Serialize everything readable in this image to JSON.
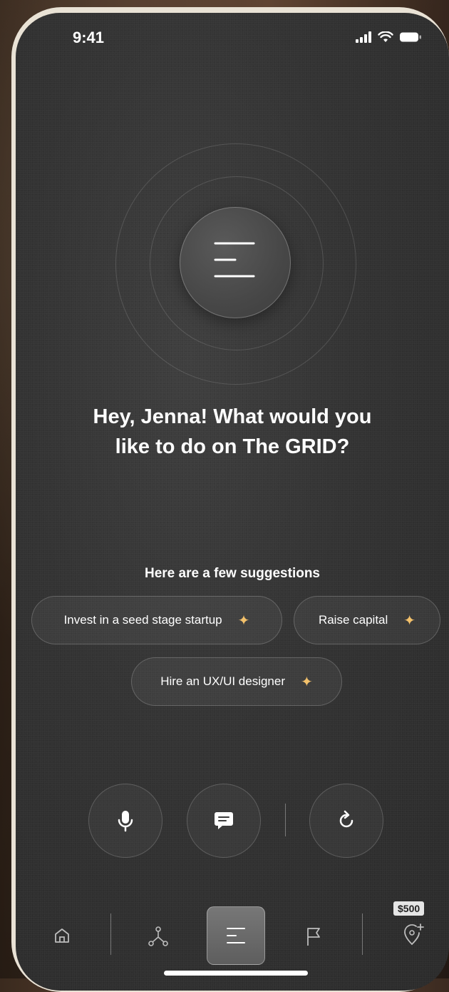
{
  "status_bar": {
    "time": "9:41"
  },
  "assistant": {
    "orb_icon": "menu-lines-icon"
  },
  "headline": {
    "line1": "Hey, Jenna! What would you",
    "line2": "like to do on The GRID?"
  },
  "suggestions": {
    "title": "Here are a few suggestions",
    "items": [
      {
        "label": "Invest in a seed stage startup",
        "icon": "sparkle-icon"
      },
      {
        "label": "Raise capital",
        "icon": "sparkle-icon"
      },
      {
        "label": "Hire an UX/UI designer",
        "icon": "sparkle-icon"
      }
    ]
  },
  "actions": [
    {
      "name": "microphone",
      "icon": "microphone-icon"
    },
    {
      "name": "chat",
      "icon": "chat-bubble-icon"
    },
    {
      "name": "refresh",
      "icon": "refresh-icon"
    }
  ],
  "bottom_nav": {
    "items": [
      "home-icon",
      "network-icon",
      "menu-lines-icon",
      "flag-icon",
      "location-plus-icon"
    ],
    "active": "menu-lines-icon",
    "badge": "$500"
  },
  "colors": {
    "accent": "#f3c16b",
    "background": "#333333",
    "text": "#ffffff"
  }
}
